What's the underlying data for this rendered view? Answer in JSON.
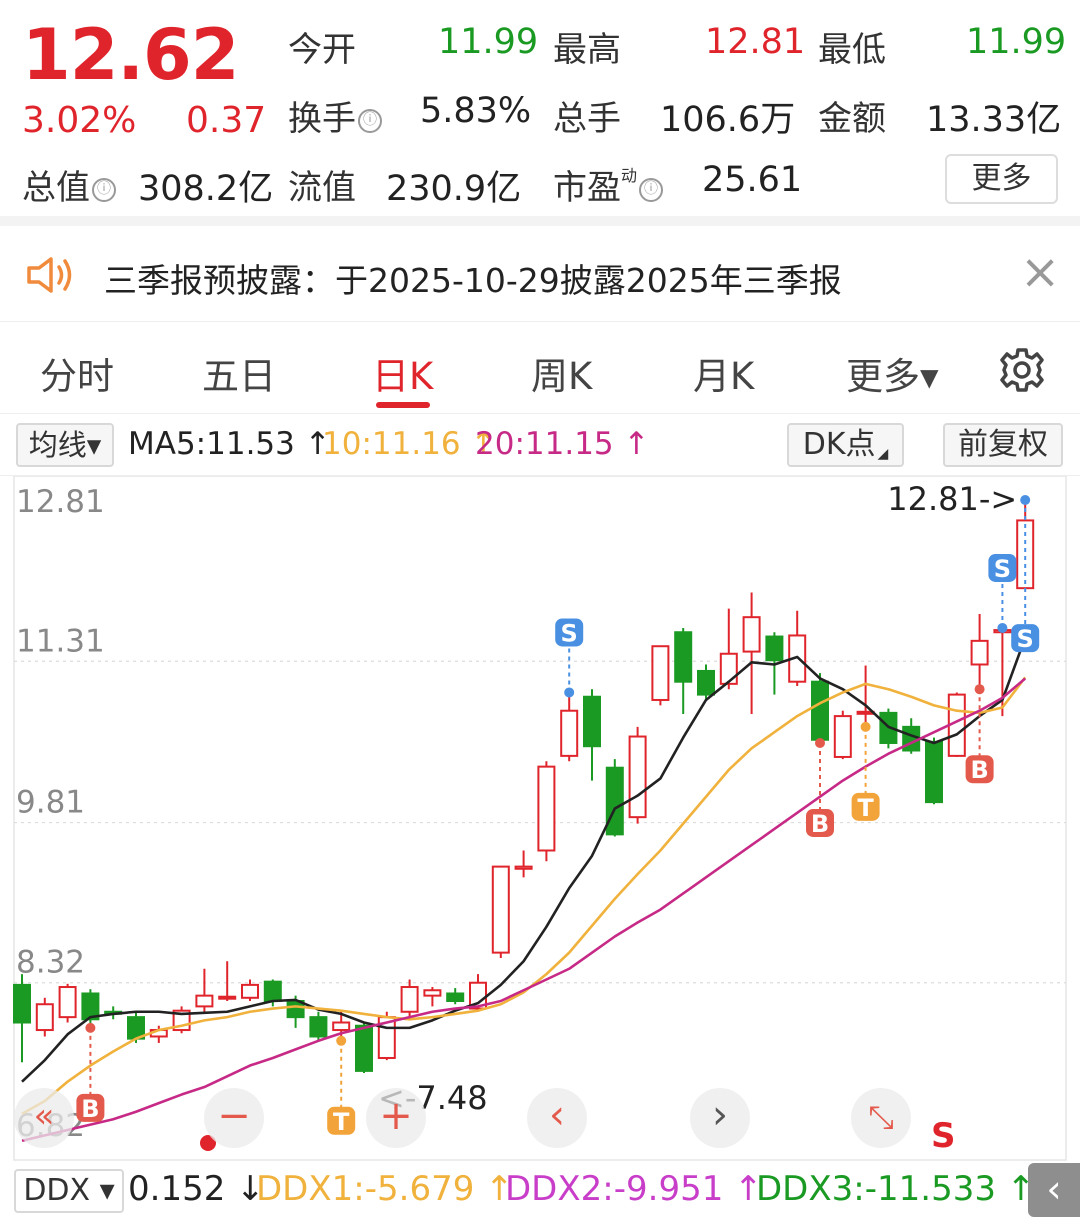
{
  "quote": {
    "price": "12.62",
    "change_pct": "3.02%",
    "change_abs": "0.37",
    "open_label": "今开",
    "open": "11.99",
    "high_label": "最高",
    "high": "12.81",
    "low_label": "最低",
    "low": "11.99",
    "turnover_label": "换手",
    "turnover": "5.83%",
    "volume_label": "总手",
    "volume": "106.6万",
    "amount_label": "金额",
    "amount": "13.33亿",
    "total_cap_label": "总值",
    "total_cap": "308.2亿",
    "float_cap_label": "流值",
    "float_cap": "230.9亿",
    "pe_label": "市盈",
    "pe_sup": "动",
    "pe": "25.61",
    "more_label": "更多",
    "info_icon": "ⓘ"
  },
  "notice": {
    "icon": "speaker-icon",
    "text": "三季报预披露：于2025-10-29披露2025年三季报",
    "close": "×"
  },
  "tabs": [
    {
      "label": "分时",
      "active": false
    },
    {
      "label": "五日",
      "active": false
    },
    {
      "label": "日K",
      "active": true
    },
    {
      "label": "周K",
      "active": false
    },
    {
      "label": "月K",
      "active": false
    },
    {
      "label": "更多▾",
      "active": false
    }
  ],
  "ma_bar": {
    "selector": "均线▾",
    "ma5": "MA5:11.53 ↑",
    "ma10": "10:11.16 ↑",
    "ma20": "20:11.15 ↑",
    "dk_button": "DK点",
    "adjust_button": "前复权",
    "colors": {
      "ma5": "#222222",
      "ma10": "#f0b23c",
      "ma20": "#c62a86"
    }
  },
  "chart_data": {
    "type": "candlestick",
    "y_ticks": [
      "12.81",
      "11.31",
      "9.81",
      "8.32",
      "6.82"
    ],
    "ylim": [
      6.82,
      12.81
    ],
    "annotations": {
      "high": "12.81->",
      "low": "<-7.48"
    },
    "candles": [
      {
        "o": 8.3,
        "c": 7.95,
        "h": 8.4,
        "l": 7.58
      },
      {
        "o": 7.88,
        "c": 8.12,
        "h": 8.18,
        "l": 7.82
      },
      {
        "o": 8.0,
        "c": 8.28,
        "h": 8.31,
        "l": 7.95
      },
      {
        "o": 8.22,
        "c": 7.98,
        "h": 8.26,
        "l": 7.9
      },
      {
        "o": 8.05,
        "c": 8.04,
        "h": 8.1,
        "l": 7.98
      },
      {
        "o": 8.0,
        "c": 7.8,
        "h": 8.05,
        "l": 7.76
      },
      {
        "o": 7.82,
        "c": 7.88,
        "h": 7.92,
        "l": 7.76
      },
      {
        "o": 7.88,
        "c": 8.06,
        "h": 8.1,
        "l": 7.85
      },
      {
        "o": 8.1,
        "c": 8.2,
        "h": 8.45,
        "l": 8.05
      },
      {
        "o": 8.18,
        "c": 8.19,
        "h": 8.52,
        "l": 8.15
      },
      {
        "o": 8.18,
        "c": 8.3,
        "h": 8.35,
        "l": 8.15
      },
      {
        "o": 8.33,
        "c": 8.15,
        "h": 8.35,
        "l": 8.1
      },
      {
        "o": 8.15,
        "c": 8.0,
        "h": 8.2,
        "l": 7.9
      },
      {
        "o": 8.0,
        "c": 7.82,
        "h": 8.05,
        "l": 7.78
      },
      {
        "o": 7.88,
        "c": 7.95,
        "h": 8.05,
        "l": 7.78
      },
      {
        "o": 7.92,
        "c": 7.5,
        "h": 7.95,
        "l": 7.48
      },
      {
        "o": 7.62,
        "c": 8.0,
        "h": 8.05,
        "l": 7.6
      },
      {
        "o": 8.05,
        "c": 8.28,
        "h": 8.35,
        "l": 8.0
      },
      {
        "o": 8.2,
        "c": 8.25,
        "h": 8.28,
        "l": 8.1
      },
      {
        "o": 8.22,
        "c": 8.15,
        "h": 8.27,
        "l": 8.12
      },
      {
        "o": 8.08,
        "c": 8.32,
        "h": 8.4,
        "l": 8.05
      },
      {
        "o": 8.6,
        "c": 9.4,
        "h": 9.4,
        "l": 8.55
      },
      {
        "o": 9.38,
        "c": 9.4,
        "h": 9.55,
        "l": 9.3
      },
      {
        "o": 9.55,
        "c": 10.33,
        "h": 10.38,
        "l": 9.45
      },
      {
        "o": 10.43,
        "c": 10.85,
        "h": 11.02,
        "l": 10.38
      },
      {
        "o": 10.98,
        "c": 10.52,
        "h": 11.05,
        "l": 10.2
      },
      {
        "o": 10.32,
        "c": 9.7,
        "h": 10.4,
        "l": 9.68
      },
      {
        "o": 9.86,
        "c": 10.61,
        "h": 10.7,
        "l": 9.8
      },
      {
        "o": 10.95,
        "c": 11.45,
        "h": 11.45,
        "l": 10.9
      },
      {
        "o": 11.58,
        "c": 11.12,
        "h": 11.62,
        "l": 10.82
      },
      {
        "o": 11.22,
        "c": 11.0,
        "h": 11.28,
        "l": 10.96
      },
      {
        "o": 11.1,
        "c": 11.38,
        "h": 11.8,
        "l": 11.05
      },
      {
        "o": 11.4,
        "c": 11.72,
        "h": 11.95,
        "l": 10.82
      },
      {
        "o": 11.54,
        "c": 11.32,
        "h": 11.58,
        "l": 11.0
      },
      {
        "o": 11.12,
        "c": 11.55,
        "h": 11.78,
        "l": 11.08
      },
      {
        "o": 11.12,
        "c": 10.58,
        "h": 11.2,
        "l": 10.55
      },
      {
        "o": 10.42,
        "c": 10.8,
        "h": 10.85,
        "l": 10.4
      },
      {
        "o": 10.83,
        "c": 10.84,
        "h": 11.27,
        "l": 10.7
      },
      {
        "o": 10.83,
        "c": 10.55,
        "h": 10.87,
        "l": 10.5
      },
      {
        "o": 10.7,
        "c": 10.48,
        "h": 10.78,
        "l": 10.45
      },
      {
        "o": 10.56,
        "c": 10.0,
        "h": 10.6,
        "l": 9.98
      },
      {
        "o": 10.43,
        "c": 11.0,
        "h": 11.02,
        "l": 10.42
      },
      {
        "o": 11.28,
        "c": 11.5,
        "h": 11.75,
        "l": 11.05
      },
      {
        "o": 11.58,
        "c": 11.6,
        "h": 11.62,
        "l": 10.8
      },
      {
        "o": 11.99,
        "c": 12.62,
        "h": 12.81,
        "l": 11.99
      }
    ],
    "series": [
      {
        "name": "MA5",
        "color": "#222222",
        "values": [
          7.4,
          7.6,
          7.84,
          8.0,
          8.03,
          8.05,
          8.05,
          8.03,
          8.04,
          8.05,
          8.1,
          8.15,
          8.16,
          8.07,
          8.03,
          7.95,
          7.9,
          7.9,
          7.97,
          8.06,
          8.13,
          8.3,
          8.52,
          8.84,
          9.2,
          9.5,
          9.94,
          10.06,
          10.22,
          10.6,
          10.95,
          11.12,
          11.3,
          11.28,
          11.35,
          11.15,
          11.05,
          10.9,
          10.7,
          10.62,
          10.55,
          10.63,
          10.8,
          10.95,
          11.53
        ]
      },
      {
        "name": "MA10",
        "color": "#f0b23c",
        "values": [
          7.1,
          7.22,
          7.4,
          7.55,
          7.68,
          7.8,
          7.88,
          7.92,
          7.97,
          8.0,
          8.05,
          8.08,
          8.1,
          8.08,
          8.06,
          8.03,
          8.0,
          7.98,
          8.0,
          8.03,
          8.06,
          8.12,
          8.23,
          8.4,
          8.6,
          8.85,
          9.1,
          9.33,
          9.55,
          9.8,
          10.05,
          10.3,
          10.5,
          10.65,
          10.8,
          10.92,
          11.02,
          11.1,
          11.05,
          10.98,
          10.9,
          10.85,
          10.83,
          10.88,
          11.16
        ]
      },
      {
        "name": "MA20",
        "color": "#c62a86",
        "values": [
          6.85,
          6.9,
          6.95,
          7.0,
          7.05,
          7.12,
          7.2,
          7.28,
          7.35,
          7.45,
          7.55,
          7.62,
          7.7,
          7.78,
          7.85,
          7.9,
          7.95,
          8.0,
          8.05,
          8.08,
          8.1,
          8.15,
          8.25,
          8.35,
          8.45,
          8.6,
          8.75,
          8.88,
          9.0,
          9.15,
          9.3,
          9.45,
          9.6,
          9.75,
          9.9,
          10.05,
          10.2,
          10.33,
          10.45,
          10.55,
          10.65,
          10.75,
          10.85,
          10.97,
          11.15
        ]
      }
    ],
    "signals": [
      {
        "type": "B",
        "i": 3,
        "lab": "B",
        "color": "#e35a4c"
      },
      {
        "type": "T",
        "i": 14,
        "lab": "T",
        "color": "#f2a33a"
      },
      {
        "type": "S",
        "i": 24,
        "lab": "S",
        "color": "#4a90e2"
      },
      {
        "type": "B",
        "i": 35,
        "lab": "B",
        "color": "#e35a4c"
      },
      {
        "type": "T",
        "i": 37,
        "lab": "T",
        "color": "#f2a33a"
      },
      {
        "type": "B",
        "i": 42,
        "lab": "B",
        "color": "#e35a4c"
      },
      {
        "type": "S",
        "i": 43,
        "lab": "S",
        "color": "#4a90e2"
      },
      {
        "type": "S",
        "i": 44,
        "lab": "S",
        "color": "#4a90e2"
      }
    ],
    "colors": {
      "up": "#e0242b",
      "down": "#1a9a22"
    }
  },
  "controls": {
    "back": "«",
    "zoom_out": "−",
    "zoom_in": "+",
    "prev": "‹",
    "next": "›",
    "fullscreen": "⤡",
    "s_marker": "S"
  },
  "indicator": {
    "selector": "DDX ▾",
    "value": "0.152 ↓",
    "ddx1": "DDX1:-5.679 ↑",
    "ddx2": "DDX2:-9.951 ↑",
    "ddx3": "DDX3:-11.533 ↑",
    "collapse": "‹"
  }
}
